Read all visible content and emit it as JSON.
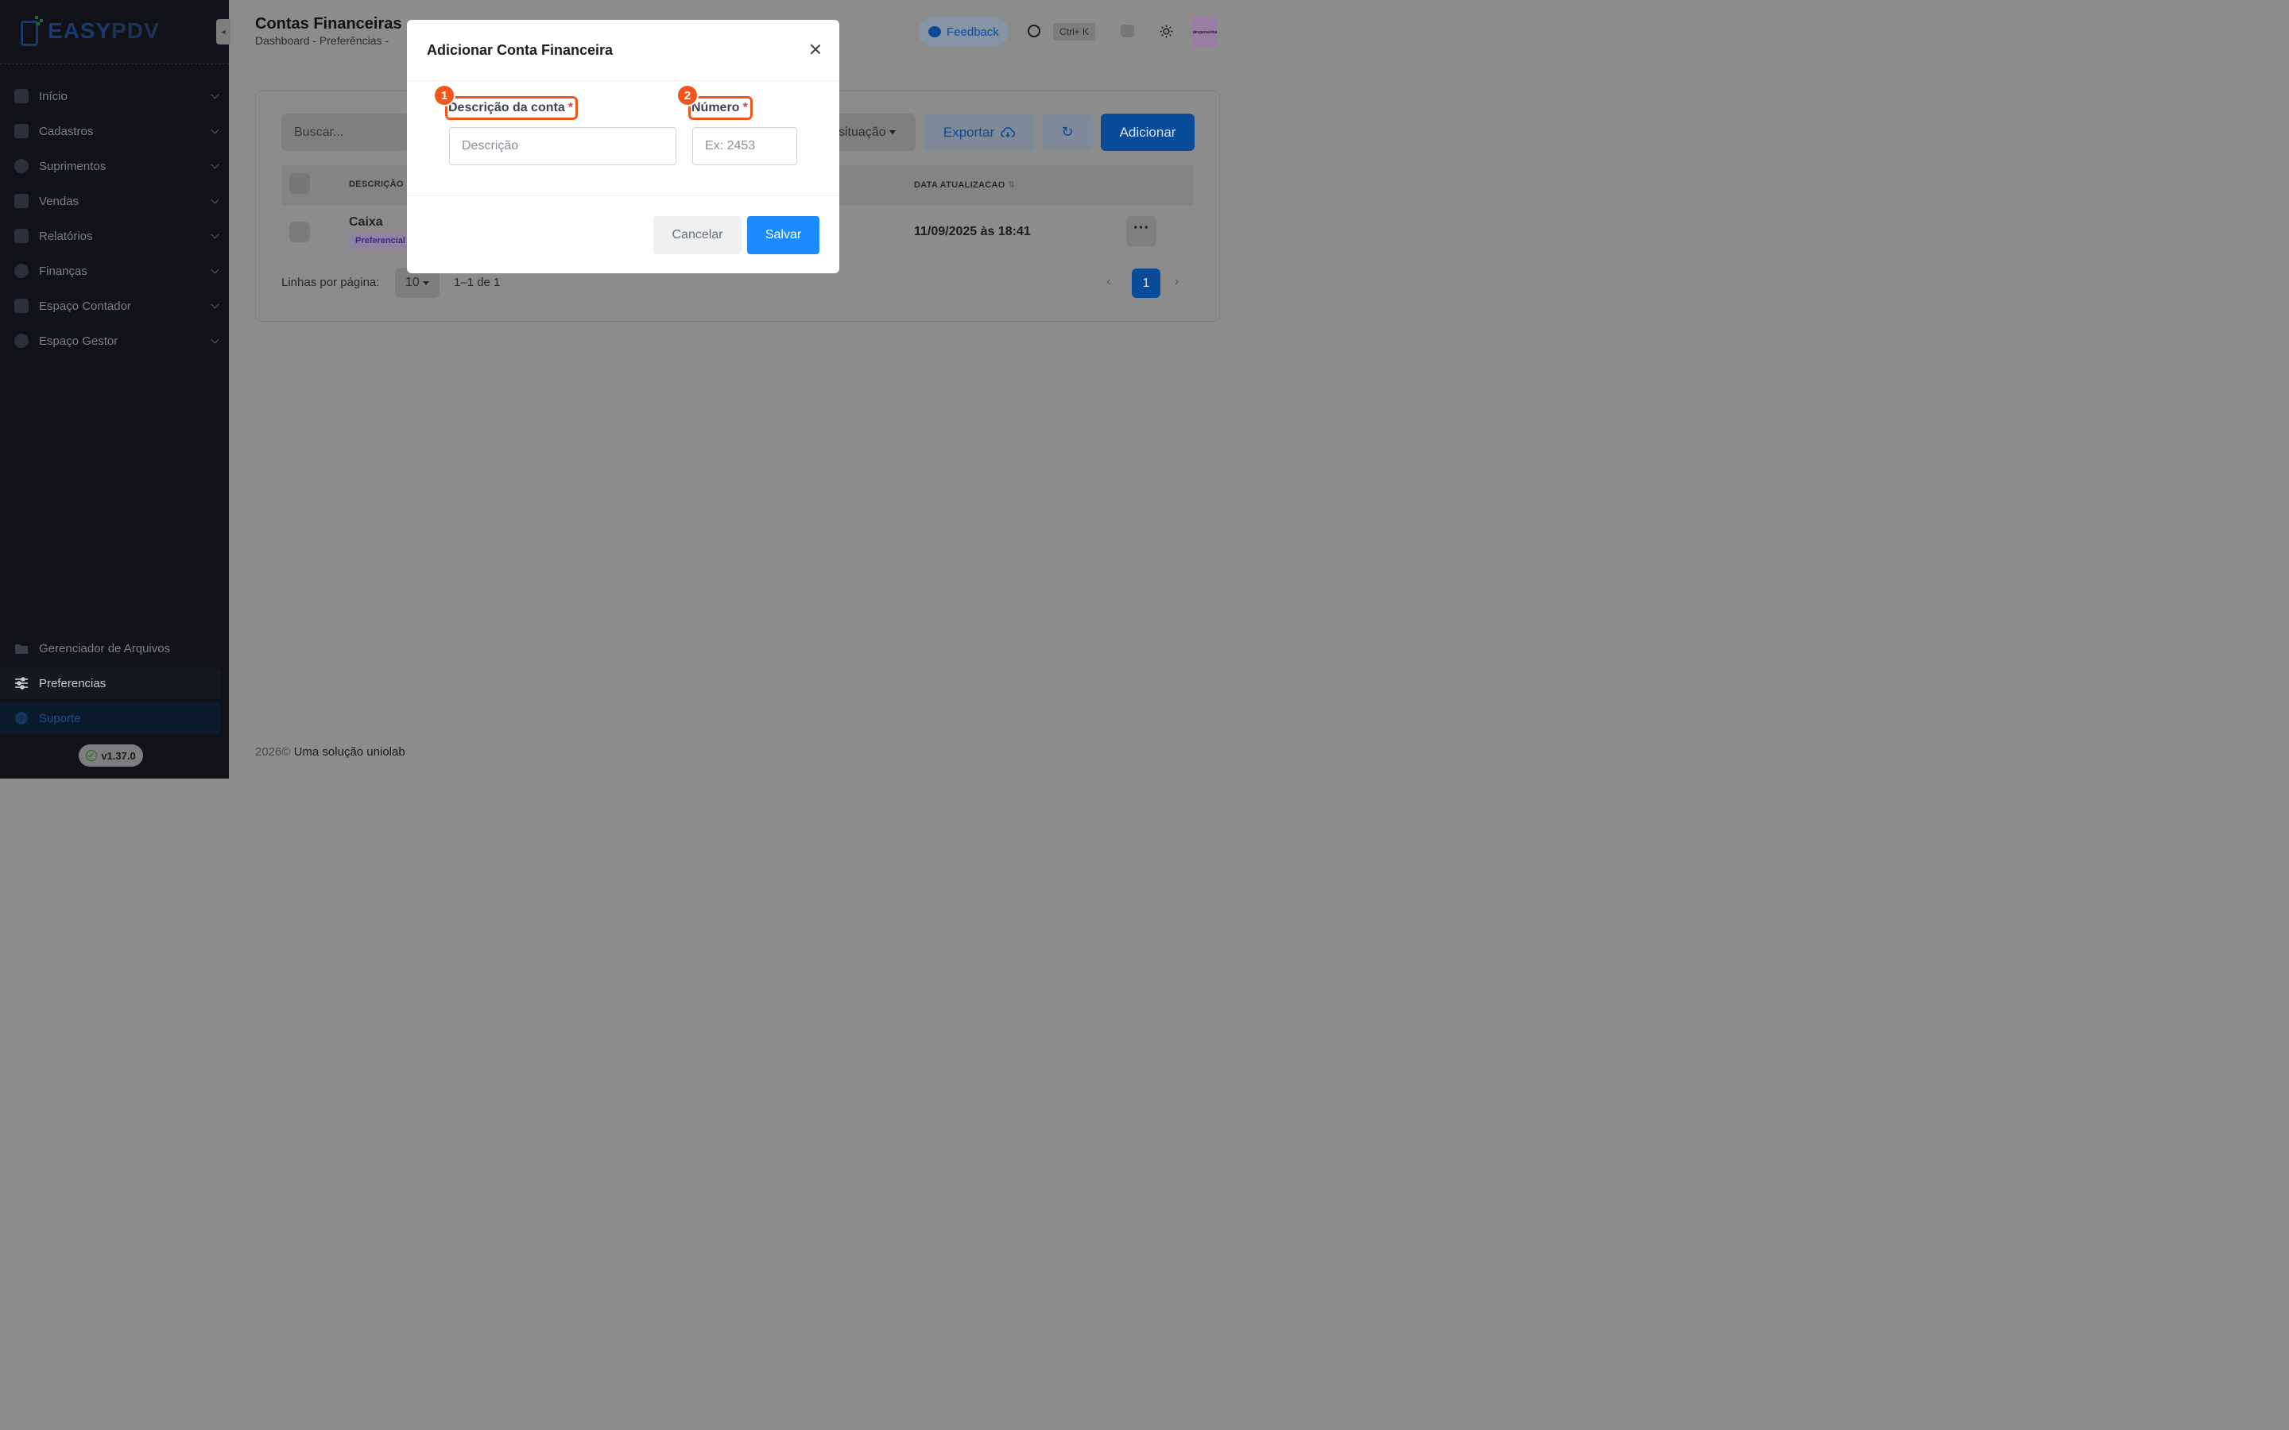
{
  "app": {
    "logo_part1": "EASY",
    "logo_part2": "PDV",
    "version": "v1.37.0"
  },
  "sidebar": {
    "items": [
      {
        "label": "Início",
        "icon": "grid-icon"
      },
      {
        "label": "Cadastros",
        "icon": "id-card-icon"
      },
      {
        "label": "Suprimentos",
        "icon": "box-icon"
      },
      {
        "label": "Vendas",
        "icon": "cash-register-icon"
      },
      {
        "label": "Relatórios",
        "icon": "chart-icon"
      },
      {
        "label": "Finanças",
        "icon": "dollar-icon"
      },
      {
        "label": "Espaço Contador",
        "icon": "calculator-icon"
      },
      {
        "label": "Espaço Gestor",
        "icon": "manager-icon"
      }
    ],
    "bottom": [
      {
        "label": "Gerenciador de Arquivos",
        "icon": "folder-icon"
      },
      {
        "label": "Preferencias",
        "icon": "sliders-icon"
      },
      {
        "label": "Suporte",
        "icon": "help-icon"
      }
    ]
  },
  "header": {
    "title": "Contas Financeiras",
    "breadcrumb": "Dashboard  -  Preferências  -",
    "feedback_label": "Feedback",
    "shortcut": "Ctrl+ K",
    "avatar_text": "despensinha"
  },
  "toolbar": {
    "search_placeholder": "Buscar...",
    "filter_label": "situação",
    "export_label": "Exportar",
    "add_label": "Adicionar"
  },
  "table": {
    "headers": {
      "description": "DESCRIÇÃO",
      "updated": "DATA ATUALIZACAO"
    },
    "rows": [
      {
        "name": "Caixa",
        "badge": "Preferencial",
        "updated": "11/09/2025 às 18:41"
      }
    ]
  },
  "pagination": {
    "rows_label": "Linhas por página:",
    "rows_value": "10",
    "range": "1–1 de 1",
    "current_page": "1"
  },
  "footer": {
    "year": "2026©",
    "text": " Uma solução uniolab"
  },
  "modal": {
    "title": "Adicionar Conta Financeira",
    "fields": [
      {
        "marker": "1",
        "label": "Descrição da conta",
        "required": "*",
        "placeholder": "Descrição"
      },
      {
        "marker": "2",
        "label": "Número",
        "required": "*",
        "placeholder": "Ex: 2453"
      }
    ],
    "cancel_label": "Cancelar",
    "save_label": "Salvar"
  },
  "colors": {
    "primary": "#1a8cff",
    "highlight": "#f2551c",
    "required": "#e5384b",
    "sidebar_bg": "#101217"
  }
}
